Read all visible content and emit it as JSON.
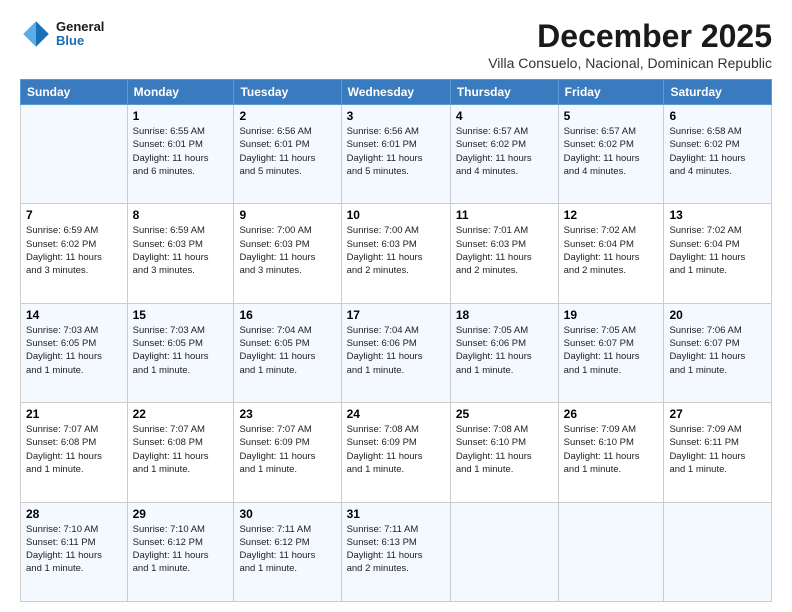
{
  "header": {
    "logo": {
      "line1": "General",
      "line2": "Blue"
    },
    "month": "December 2025",
    "location": "Villa Consuelo, Nacional, Dominican Republic"
  },
  "columns": [
    "Sunday",
    "Monday",
    "Tuesday",
    "Wednesday",
    "Thursday",
    "Friday",
    "Saturday"
  ],
  "weeks": [
    [
      {
        "day": "",
        "info": ""
      },
      {
        "day": "1",
        "info": "Sunrise: 6:55 AM\nSunset: 6:01 PM\nDaylight: 11 hours\nand 6 minutes."
      },
      {
        "day": "2",
        "info": "Sunrise: 6:56 AM\nSunset: 6:01 PM\nDaylight: 11 hours\nand 5 minutes."
      },
      {
        "day": "3",
        "info": "Sunrise: 6:56 AM\nSunset: 6:01 PM\nDaylight: 11 hours\nand 5 minutes."
      },
      {
        "day": "4",
        "info": "Sunrise: 6:57 AM\nSunset: 6:02 PM\nDaylight: 11 hours\nand 4 minutes."
      },
      {
        "day": "5",
        "info": "Sunrise: 6:57 AM\nSunset: 6:02 PM\nDaylight: 11 hours\nand 4 minutes."
      },
      {
        "day": "6",
        "info": "Sunrise: 6:58 AM\nSunset: 6:02 PM\nDaylight: 11 hours\nand 4 minutes."
      }
    ],
    [
      {
        "day": "7",
        "info": "Sunrise: 6:59 AM\nSunset: 6:02 PM\nDaylight: 11 hours\nand 3 minutes."
      },
      {
        "day": "8",
        "info": "Sunrise: 6:59 AM\nSunset: 6:03 PM\nDaylight: 11 hours\nand 3 minutes."
      },
      {
        "day": "9",
        "info": "Sunrise: 7:00 AM\nSunset: 6:03 PM\nDaylight: 11 hours\nand 3 minutes."
      },
      {
        "day": "10",
        "info": "Sunrise: 7:00 AM\nSunset: 6:03 PM\nDaylight: 11 hours\nand 2 minutes."
      },
      {
        "day": "11",
        "info": "Sunrise: 7:01 AM\nSunset: 6:03 PM\nDaylight: 11 hours\nand 2 minutes."
      },
      {
        "day": "12",
        "info": "Sunrise: 7:02 AM\nSunset: 6:04 PM\nDaylight: 11 hours\nand 2 minutes."
      },
      {
        "day": "13",
        "info": "Sunrise: 7:02 AM\nSunset: 6:04 PM\nDaylight: 11 hours\nand 1 minute."
      }
    ],
    [
      {
        "day": "14",
        "info": "Sunrise: 7:03 AM\nSunset: 6:05 PM\nDaylight: 11 hours\nand 1 minute."
      },
      {
        "day": "15",
        "info": "Sunrise: 7:03 AM\nSunset: 6:05 PM\nDaylight: 11 hours\nand 1 minute."
      },
      {
        "day": "16",
        "info": "Sunrise: 7:04 AM\nSunset: 6:05 PM\nDaylight: 11 hours\nand 1 minute."
      },
      {
        "day": "17",
        "info": "Sunrise: 7:04 AM\nSunset: 6:06 PM\nDaylight: 11 hours\nand 1 minute."
      },
      {
        "day": "18",
        "info": "Sunrise: 7:05 AM\nSunset: 6:06 PM\nDaylight: 11 hours\nand 1 minute."
      },
      {
        "day": "19",
        "info": "Sunrise: 7:05 AM\nSunset: 6:07 PM\nDaylight: 11 hours\nand 1 minute."
      },
      {
        "day": "20",
        "info": "Sunrise: 7:06 AM\nSunset: 6:07 PM\nDaylight: 11 hours\nand 1 minute."
      }
    ],
    [
      {
        "day": "21",
        "info": "Sunrise: 7:07 AM\nSunset: 6:08 PM\nDaylight: 11 hours\nand 1 minute."
      },
      {
        "day": "22",
        "info": "Sunrise: 7:07 AM\nSunset: 6:08 PM\nDaylight: 11 hours\nand 1 minute."
      },
      {
        "day": "23",
        "info": "Sunrise: 7:07 AM\nSunset: 6:09 PM\nDaylight: 11 hours\nand 1 minute."
      },
      {
        "day": "24",
        "info": "Sunrise: 7:08 AM\nSunset: 6:09 PM\nDaylight: 11 hours\nand 1 minute."
      },
      {
        "day": "25",
        "info": "Sunrise: 7:08 AM\nSunset: 6:10 PM\nDaylight: 11 hours\nand 1 minute."
      },
      {
        "day": "26",
        "info": "Sunrise: 7:09 AM\nSunset: 6:10 PM\nDaylight: 11 hours\nand 1 minute."
      },
      {
        "day": "27",
        "info": "Sunrise: 7:09 AM\nSunset: 6:11 PM\nDaylight: 11 hours\nand 1 minute."
      }
    ],
    [
      {
        "day": "28",
        "info": "Sunrise: 7:10 AM\nSunset: 6:11 PM\nDaylight: 11 hours\nand 1 minute."
      },
      {
        "day": "29",
        "info": "Sunrise: 7:10 AM\nSunset: 6:12 PM\nDaylight: 11 hours\nand 1 minute."
      },
      {
        "day": "30",
        "info": "Sunrise: 7:11 AM\nSunset: 6:12 PM\nDaylight: 11 hours\nand 1 minute."
      },
      {
        "day": "31",
        "info": "Sunrise: 7:11 AM\nSunset: 6:13 PM\nDaylight: 11 hours\nand 2 minutes."
      },
      {
        "day": "",
        "info": ""
      },
      {
        "day": "",
        "info": ""
      },
      {
        "day": "",
        "info": ""
      }
    ]
  ]
}
